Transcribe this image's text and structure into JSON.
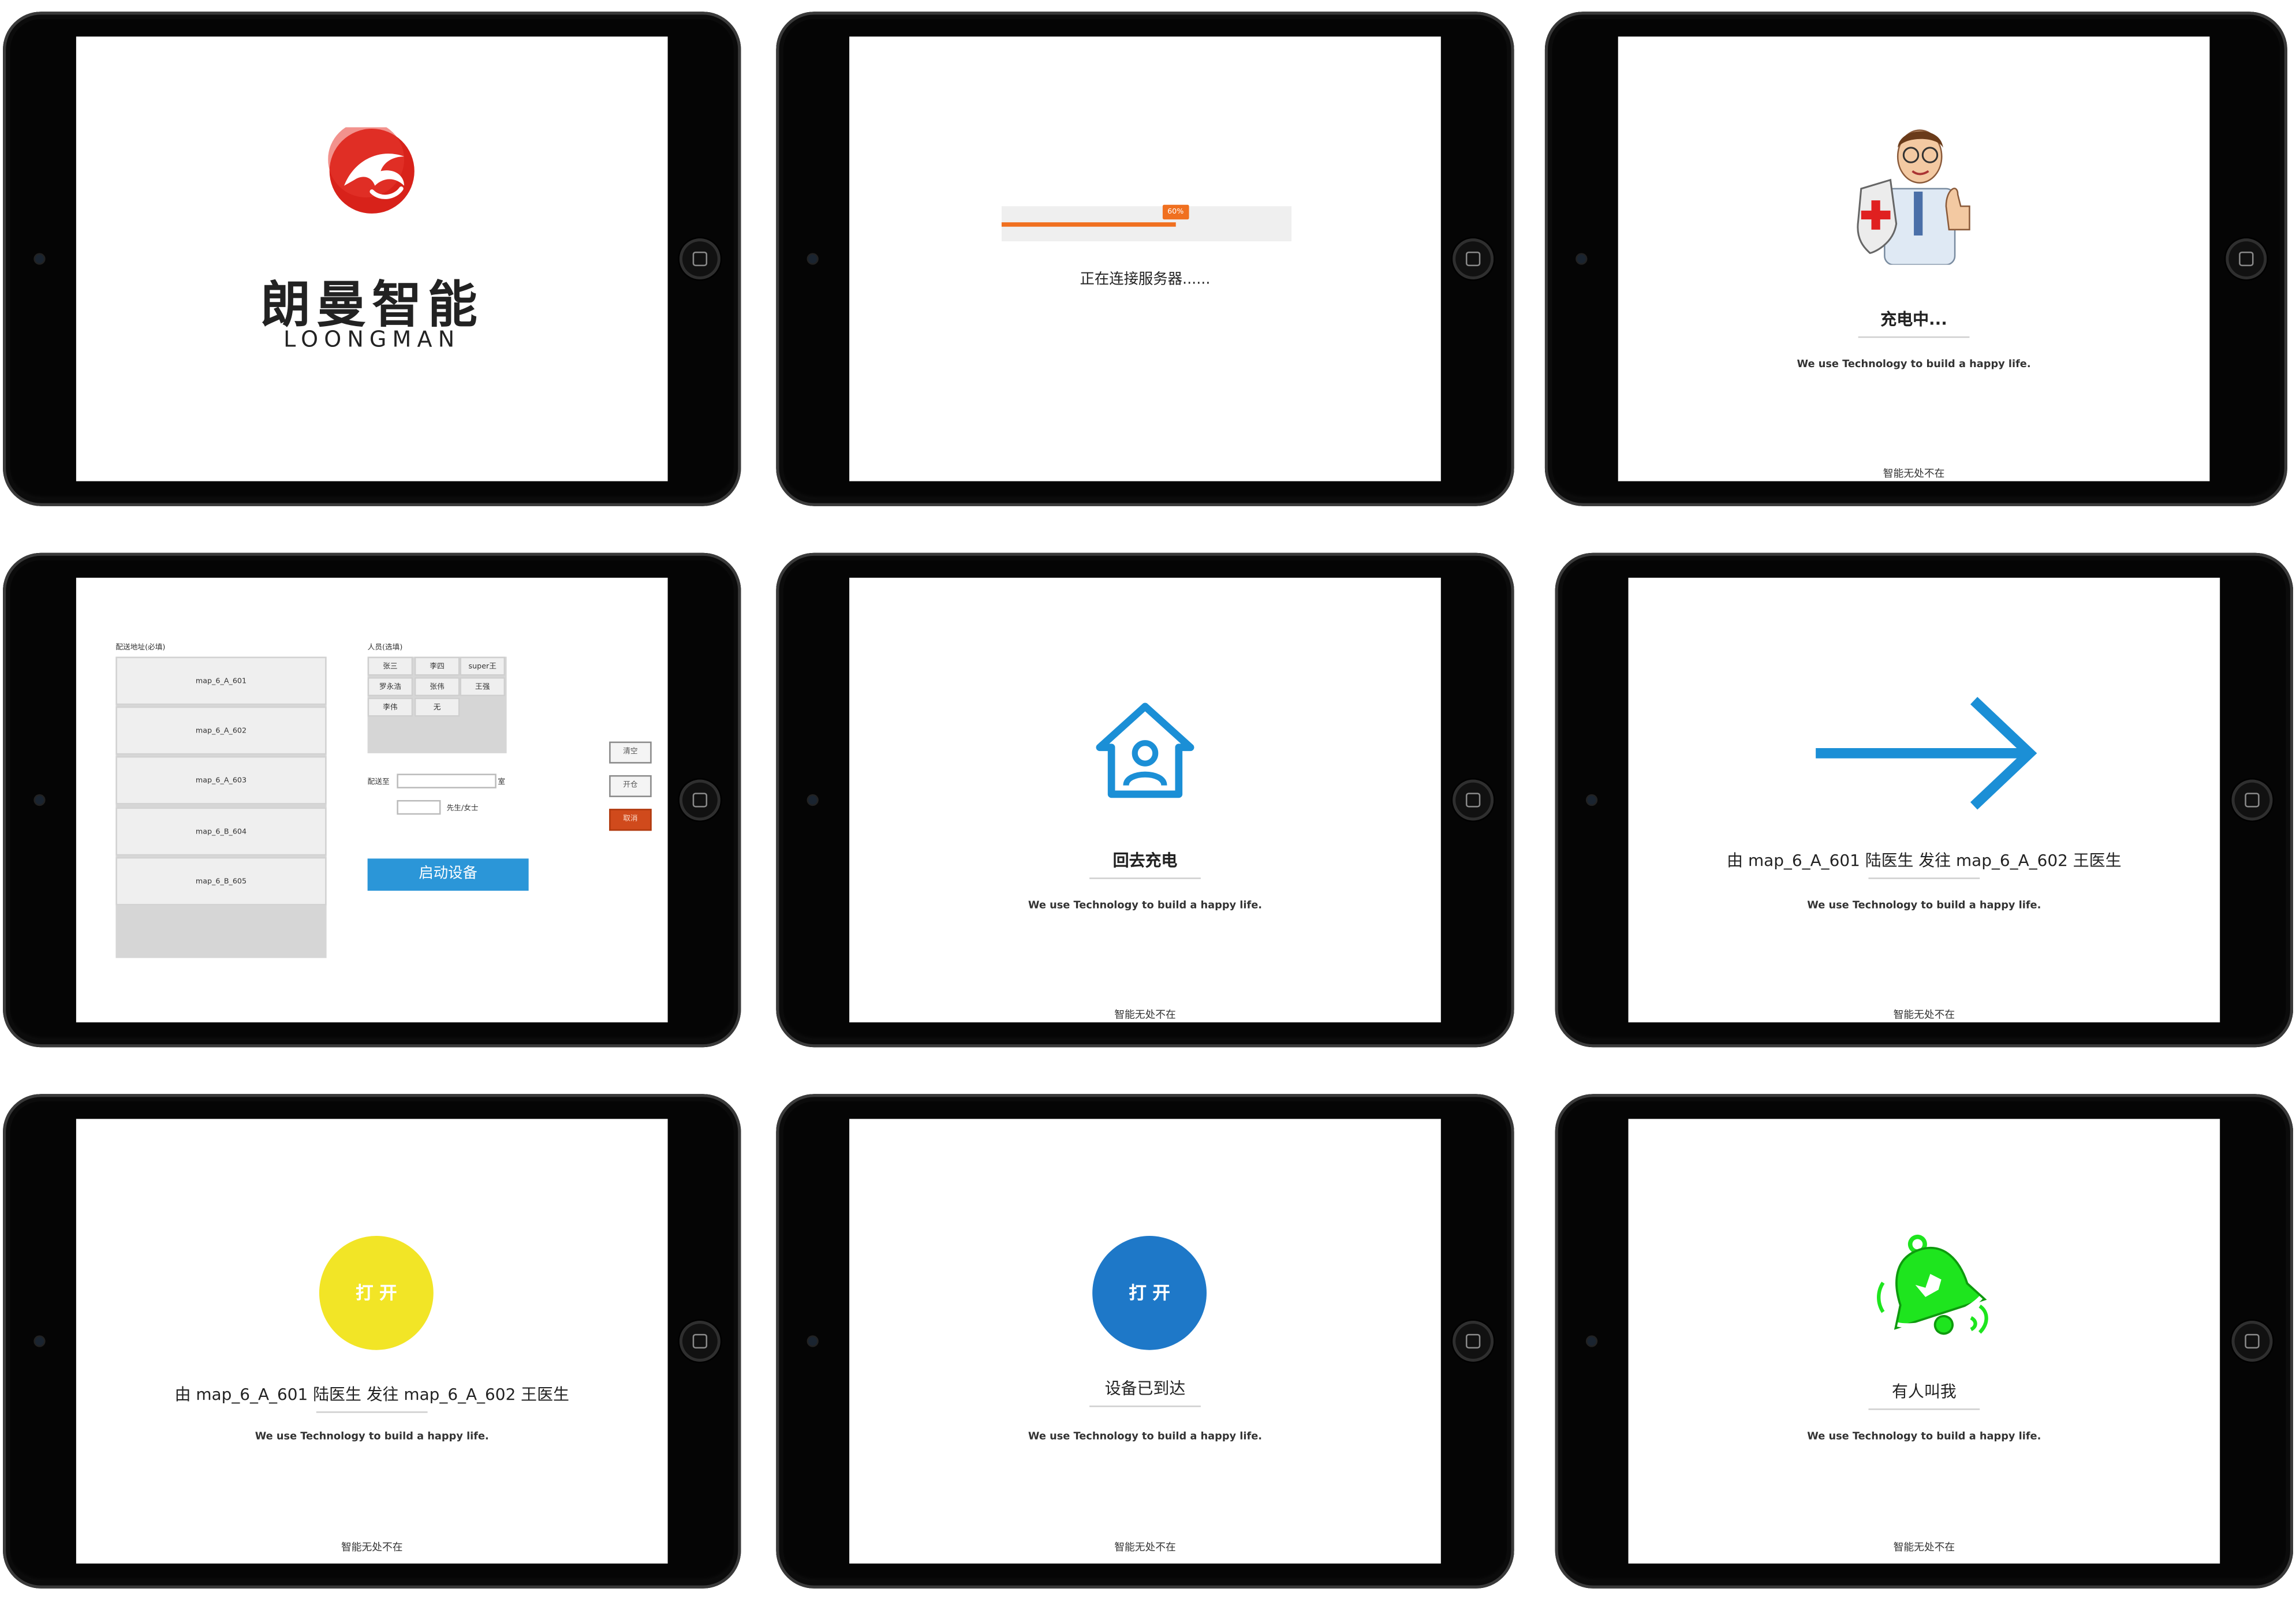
{
  "splash": {
    "brand_cn": "朗曼智能",
    "brand_en": "LOONGMAN",
    "logo_color": "#d8221a"
  },
  "loading": {
    "progress_badge": "60%",
    "progress": 0.6,
    "status": "正在连接服务器......",
    "accent": "#f07020"
  },
  "charging": {
    "title": "充电中...",
    "tagline": "We use Technology to build a happy life.",
    "footer": "智能无处不在"
  },
  "dispatch": {
    "address_label": "配送地址(必填)",
    "addresses": [
      "map_6_A_601",
      "map_6_A_602",
      "map_6_A_603",
      "map_6_B_604",
      "map_6_B_605"
    ],
    "personnel_label": "人员(选填)",
    "people": [
      "张三",
      "李四",
      "super王",
      "罗永浩",
      "张伟",
      "王强",
      "李伟",
      "无"
    ],
    "deliver_to_label": "配送至",
    "room_suffix": "室",
    "recipient_suffix": "先生/女士",
    "start_button": "启动设备",
    "side_buttons": [
      "清空",
      "开仓",
      "取消"
    ],
    "accent": "#2b96d8"
  },
  "return_charge": {
    "title": "回去充电",
    "tagline": "We use Technology to build a happy life.",
    "footer": "智能无处不在",
    "icon_color": "#1b8fd6"
  },
  "in_transit": {
    "title": "由 map_6_A_601 陆医生 发往 map_6_A_602 王医生",
    "tagline": "We use Technology to build a happy life.",
    "footer": "智能无处不在",
    "icon_color": "#1b8fd6"
  },
  "open_yellow": {
    "button": "打 开",
    "title": "由 map_6_A_601 陆医生 发往 map_6_A_602 王医生",
    "tagline": "We use Technology to build a happy life.",
    "footer": "智能无处不在",
    "button_color": "#f2e526"
  },
  "arrived": {
    "button": "打 开",
    "title": "设备已到达",
    "tagline": "We use Technology to build a happy life.",
    "footer": "智能无处不在",
    "button_color": "#1e78c8"
  },
  "calling": {
    "title": "有人叫我",
    "tagline": "We use Technology to build a happy life.",
    "footer": "智能无处不在",
    "icon_color": "#1ee51e"
  }
}
